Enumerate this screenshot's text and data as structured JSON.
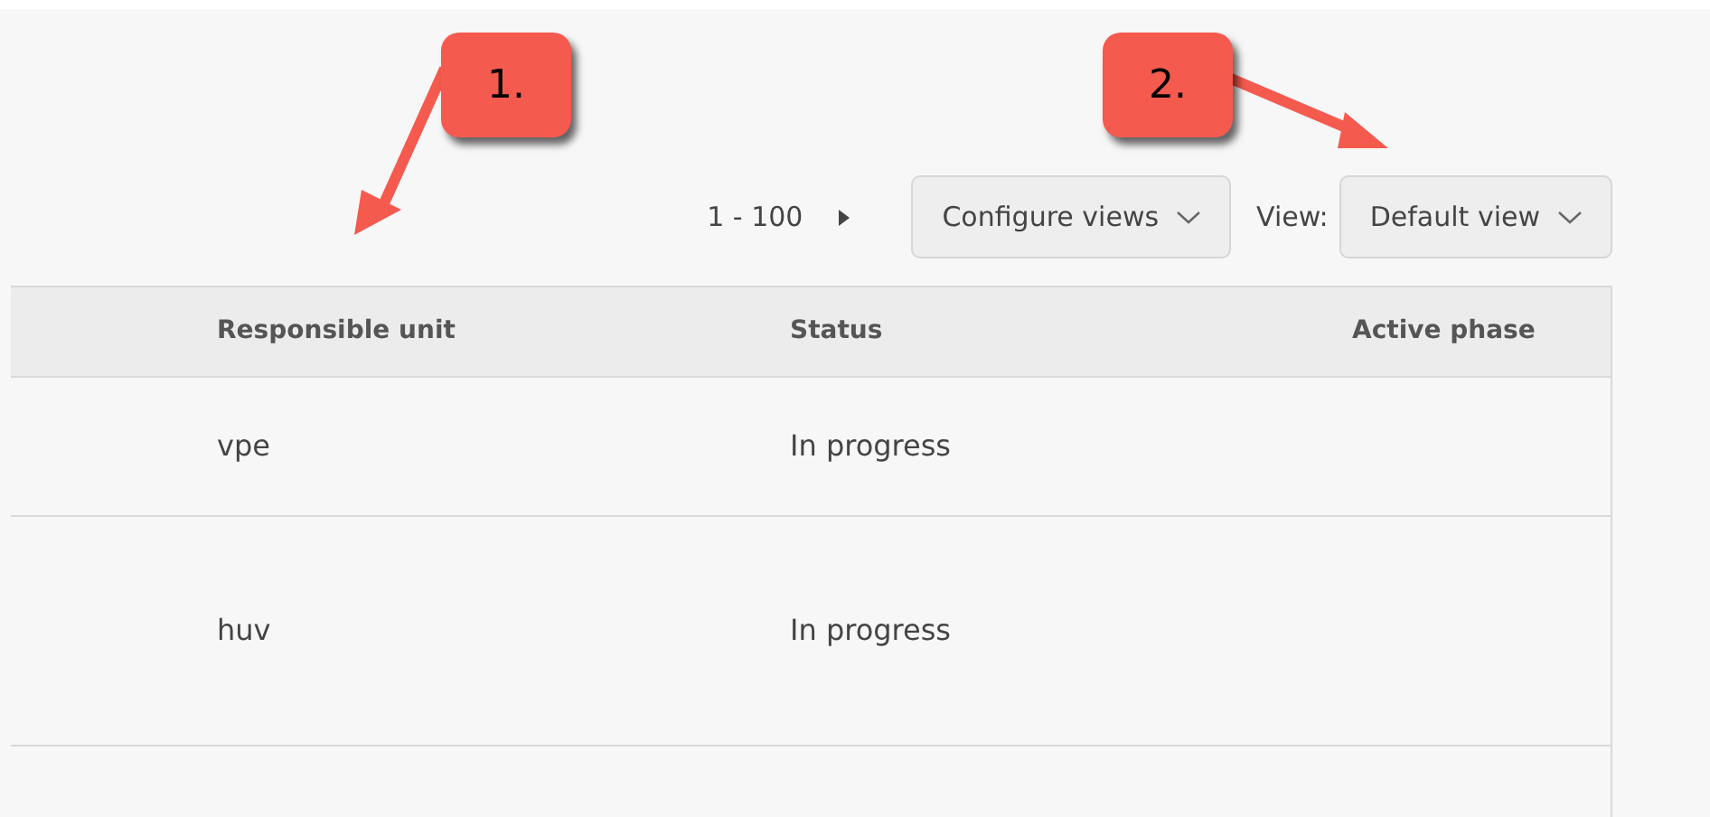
{
  "toolbar": {
    "range": "1 - 100",
    "configure_button": "Configure views",
    "view_label": "View:",
    "view_select": "Default view"
  },
  "table": {
    "columns": [
      "",
      "Responsible unit",
      "Status",
      "Active phase"
    ],
    "rows": [
      {
        "cells": [
          "",
          "vpe",
          "In progress",
          ""
        ]
      },
      {
        "cells": [
          "",
          "huv",
          "In progress",
          ""
        ]
      }
    ]
  },
  "callouts": [
    {
      "label": "1."
    },
    {
      "label": "2."
    }
  ]
}
